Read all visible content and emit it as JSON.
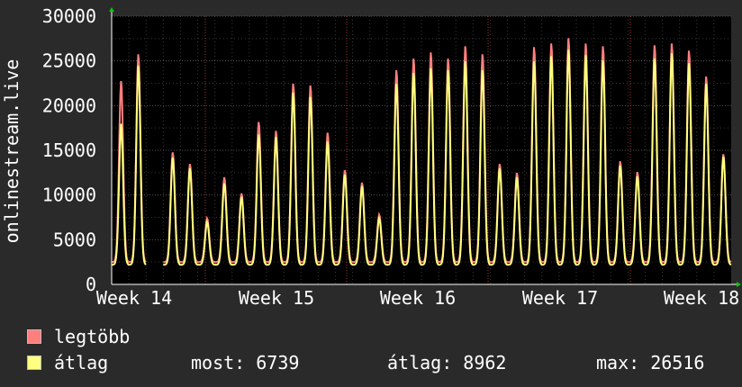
{
  "chart_data": {
    "type": "line",
    "ylabel": "onlinestream.live",
    "ylim": [
      0,
      30000
    ],
    "y_ticks": [
      0,
      5000,
      10000,
      15000,
      20000,
      25000,
      30000
    ],
    "x_ticks": [
      "Week 14",
      "Week 15",
      "Week 16",
      "Week 17",
      "Week 18"
    ],
    "grid": true,
    "series": [
      {
        "name": "legtöbb",
        "color": "#ff7f7f",
        "daily_peaks": [
          22800,
          25800,
          null,
          14800,
          13500,
          7400,
          12000,
          10200,
          18200,
          17200,
          22500,
          22300,
          17000,
          12800,
          11400,
          7800,
          24000,
          25300,
          26000,
          25300,
          26700,
          25800,
          13500,
          12500,
          26600,
          27000,
          27600,
          27000,
          26700,
          13800,
          12600,
          26800,
          27000,
          26200,
          23300,
          14600
        ]
      },
      {
        "name": "átlag",
        "color": "#ffff80",
        "daily_peaks": [
          18000,
          24500,
          null,
          14200,
          13000,
          7000,
          11300,
          9800,
          16800,
          16500,
          21500,
          21000,
          16000,
          12300,
          11000,
          7400,
          22500,
          23700,
          24200,
          24000,
          25000,
          24000,
          13000,
          12000,
          25000,
          25600,
          26300,
          25700,
          25100,
          13300,
          12100,
          25300,
          25900,
          24800,
          22500,
          14300
        ]
      }
    ]
  },
  "legend": {
    "max_label": "legtöbb",
    "avg_label": "átlag",
    "stats": {
      "most": "most: 6739",
      "atlag": "átlag: 8962",
      "max": "max: 26516"
    }
  },
  "colors": {
    "background": "#2a2a2a",
    "plot_background": "#000000",
    "grid": "#555555",
    "axis": "#ffffff",
    "max_line": "#ff7f7f",
    "avg_line": "#ffff80",
    "arrow": "#00cc00"
  }
}
